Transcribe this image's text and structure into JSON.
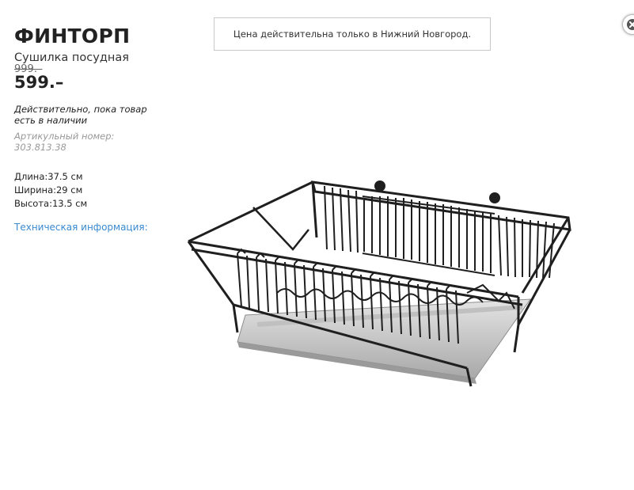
{
  "product": {
    "name": "ФИНТОРП",
    "description": "Сушилка посудная",
    "old_price": "999.–",
    "price": "599.–",
    "availability": "Действительно, пока товар есть в наличии",
    "article": "Артикульный номер: 303.813.38"
  },
  "dimensions": {
    "length": "Длина:37.5 см",
    "width": "Ширина:29 см",
    "height": "Высота:13.5 см"
  },
  "links": {
    "technical_info": "Техническая информация:"
  },
  "notice": {
    "text": "Цена действительна только в Нижний Новгород."
  },
  "icons": {
    "close": "close-icon",
    "product_image": "dish-drainer-image"
  },
  "colors": {
    "link": "#3a8ad0",
    "border": "#c8c8c8"
  }
}
